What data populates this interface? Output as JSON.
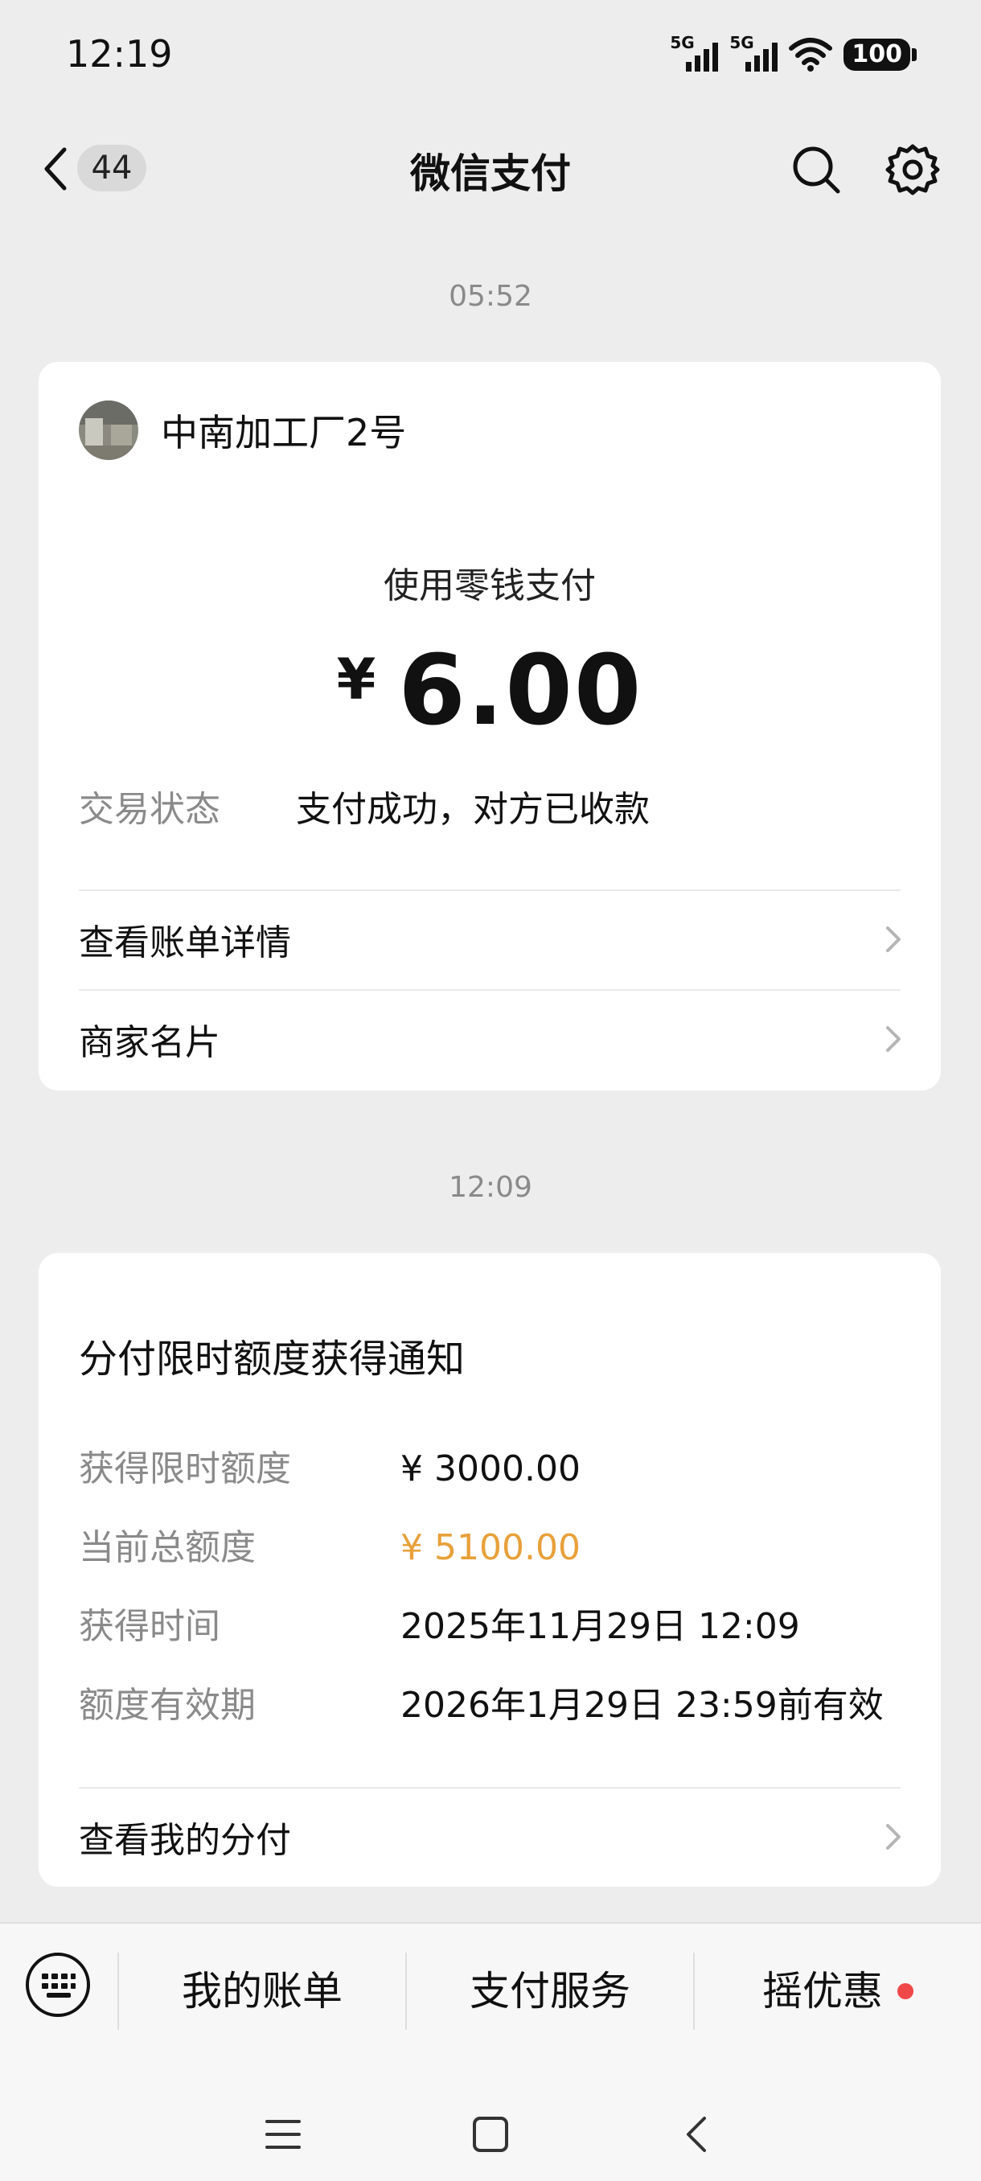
{
  "status_bar": {
    "time": "12:19",
    "signal1_label": "5G",
    "signal2_label": "5G",
    "battery": "100"
  },
  "nav": {
    "unread_count": "44",
    "title": "微信支付",
    "icons": [
      "back-icon",
      "search-icon",
      "gear-icon"
    ]
  },
  "messages": [
    {
      "time": "05:52",
      "merchant_name": "中南加工厂2号",
      "pay_method": "使用零钱支付",
      "currency": "¥",
      "amount": "6.00",
      "status_label": "交易状态",
      "status_value": "支付成功，对方已收款",
      "links": [
        "查看账单详情",
        "商家名片"
      ]
    },
    {
      "time": "12:09",
      "title": "分付限时额度获得通知",
      "rows": [
        {
          "label": "获得限时额度",
          "value": "¥ 3000.00"
        },
        {
          "label": "当前总额度",
          "value": "¥ 5100.00"
        },
        {
          "label": "获得时间",
          "value": "2025年11月29日 12:09"
        },
        {
          "label": "额度有效期",
          "value": "2026年1月29日 23:59前有效"
        }
      ],
      "link": "查看我的分付"
    }
  ],
  "bottom_menu": {
    "items": [
      "我的账单",
      "支付服务",
      "摇优惠"
    ],
    "accent_orange": "#e8a03a",
    "dot_color": "#f04848"
  }
}
